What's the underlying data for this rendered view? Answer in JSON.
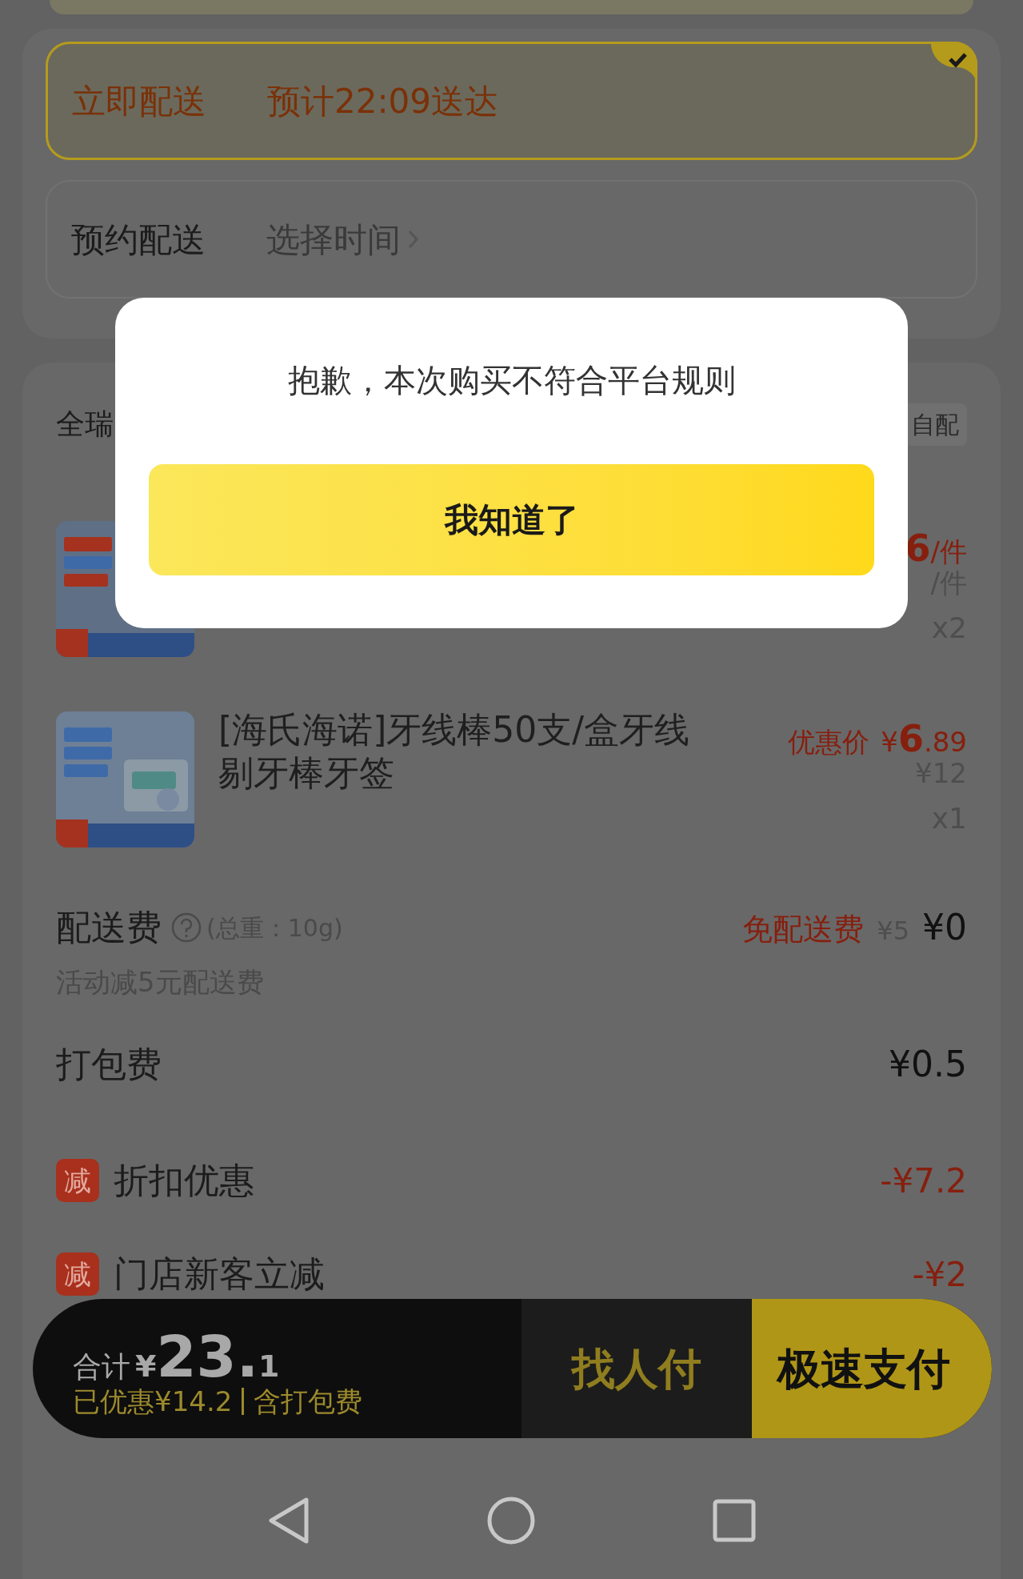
{
  "delivery_options": [
    {
      "label": "立即配送",
      "detail": "预计22:09送达",
      "selected": true
    },
    {
      "label": "预约配送",
      "detail": "选择时间",
      "selected": false
    }
  ],
  "store": {
    "name": "全瑞",
    "badge": "自配"
  },
  "items": [
    {
      "price_main": "6",
      "price_rest": "/件",
      "original_price": "/件",
      "quantity": "x2"
    },
    {
      "title": "[海氏海诺]牙线棒50支/盒牙线剔牙棒牙签",
      "price_label": "优惠价",
      "price_currency": "¥",
      "price_main": "6",
      "price_rest": ".89",
      "original_price": "¥12",
      "quantity": "x1"
    }
  ],
  "delivery_fee": {
    "label": "配送费",
    "weight": "(总重：10g)",
    "promo": "免配送费",
    "original": "¥5",
    "amount": "¥0",
    "note": "活动减5元配送费"
  },
  "packing_fee": {
    "label": "打包费",
    "amount": "¥0.5"
  },
  "discounts": [
    {
      "badge": "减",
      "label": "折扣优惠",
      "amount": "-¥7.2"
    },
    {
      "badge": "减",
      "label": "门店新客立减",
      "amount": "-¥2"
    }
  ],
  "checkout_bar": {
    "total_label": "合计",
    "currency": "¥",
    "total_main": "23.",
    "total_rest": "1",
    "saved": "已优惠¥14.2",
    "packing_note": "含打包费",
    "secondary_button": "找人付",
    "primary_button": "极速支付"
  },
  "dialog": {
    "message": "抱歉，本次购买不符合平台规则",
    "confirm": "我知道了"
  }
}
